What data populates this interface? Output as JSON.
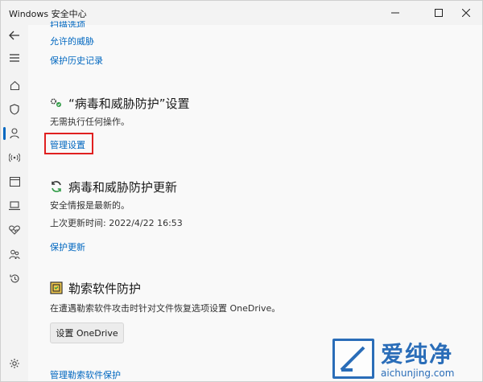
{
  "window": {
    "title": "Windows 安全中心"
  },
  "nav": {
    "items": [
      "back-icon",
      "menu-icon",
      "home-icon",
      "shield-icon",
      "account-icon",
      "network-icon",
      "app-browser-icon",
      "device-security-icon",
      "health-icon",
      "family-icon",
      "history-icon",
      "settings-icon"
    ]
  },
  "top_links": {
    "scan_options": "扫描选项",
    "allowed_threats": "允许的威胁",
    "protection_history": "保护历史记录"
  },
  "settings_section": {
    "title": "“病毒和威胁防护”设置",
    "status": "无需执行任何操作。",
    "manage_link": "管理设置"
  },
  "updates_section": {
    "title": "病毒和威胁防护更新",
    "status": "安全情报是最新的。",
    "last_update": "上次更新时间: 2022/4/22 16:53",
    "update_link": "保护更新"
  },
  "ransomware_section": {
    "title": "勒索软件防护",
    "description": "在遭遇勒索软件攻击时针对文件恢复选项设置 OneDrive。",
    "setup_button": "设置 OneDrive",
    "manage_link": "管理勒索软件保护"
  },
  "watermark": {
    "brand": "爱纯净",
    "url": "aichunjing.com"
  }
}
